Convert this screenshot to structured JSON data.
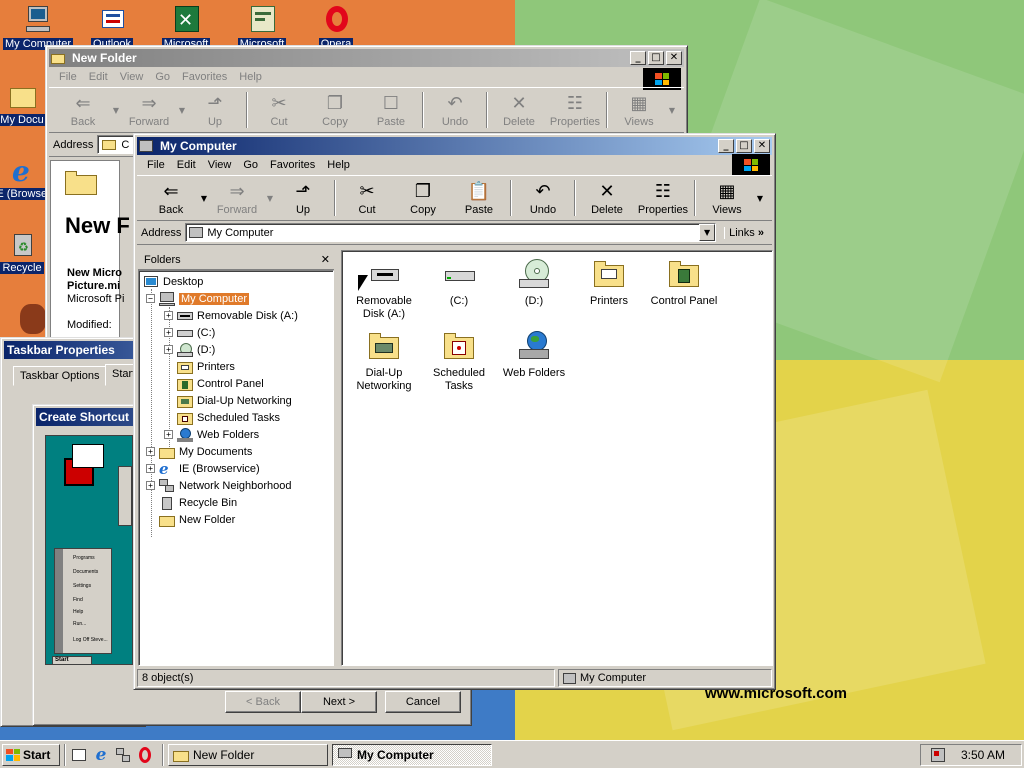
{
  "desktop": {
    "icons": [
      {
        "label": "My Computer",
        "icon": "computer-icon"
      },
      {
        "label": "Outlook",
        "icon": "outlook-icon"
      },
      {
        "label": "Microsoft",
        "icon": "excel-icon"
      },
      {
        "label": "Microsoft",
        "icon": "project-icon"
      },
      {
        "label": "Opera",
        "icon": "opera-icon"
      },
      {
        "label": "My Docu",
        "icon": "documents-folder-icon"
      },
      {
        "label": "IE (Browser",
        "icon": "ie-icon"
      },
      {
        "label": "Recycle",
        "icon": "recycle-bin-icon"
      }
    ],
    "watermark": "www.microsoft.com"
  },
  "new_folder_window": {
    "title": "New Folder",
    "menu": [
      "File",
      "Edit",
      "View",
      "Go",
      "Favorites",
      "Help"
    ],
    "toolbar": [
      "Back",
      "Forward",
      "Up",
      "Cut",
      "Copy",
      "Paste",
      "Undo",
      "Delete",
      "Properties",
      "Views"
    ],
    "address_label": "Address",
    "address_value": "C",
    "content_title": "New F",
    "content_lines": [
      "New Micro",
      "Picture.mi",
      "Microsoft Pi"
    ],
    "modified_label": "Modified:"
  },
  "taskbar_properties": {
    "title": "Taskbar Properties",
    "tabs": [
      "Taskbar Options",
      "Start"
    ]
  },
  "create_shortcut": {
    "title": "Create Shortcut",
    "preview_menu": [
      "Programs",
      "Documents",
      "Settings",
      "Find",
      "Help",
      "Run...",
      "Log Off Steve..."
    ],
    "preview_start": "Start",
    "buttons": {
      "back": "< Back",
      "next": "Next >",
      "cancel": "Cancel"
    }
  },
  "my_computer_window": {
    "title": "My Computer",
    "menu": [
      "File",
      "Edit",
      "View",
      "Go",
      "Favorites",
      "Help"
    ],
    "toolbar": [
      {
        "label": "Back",
        "glyph": "⇐",
        "enabled": true
      },
      {
        "label": "Forward",
        "glyph": "⇒",
        "enabled": false
      },
      {
        "label": "Up",
        "glyph": "⬏",
        "enabled": true
      },
      {
        "label": "Cut",
        "glyph": "✂",
        "enabled": true
      },
      {
        "label": "Copy",
        "glyph": "❐",
        "enabled": true
      },
      {
        "label": "Paste",
        "glyph": "📋",
        "enabled": true
      },
      {
        "label": "Undo",
        "glyph": "↶",
        "enabled": true
      },
      {
        "label": "Delete",
        "glyph": "✕",
        "enabled": true
      },
      {
        "label": "Properties",
        "glyph": "☷",
        "enabled": true
      },
      {
        "label": "Views",
        "glyph": "▦",
        "enabled": true
      }
    ],
    "address_label": "Address",
    "address_value": "My Computer",
    "links_label": "Links",
    "folders_header": "Folders",
    "tree": [
      {
        "label": "Desktop",
        "level": 0,
        "expander": "",
        "icon": "desktop-icon"
      },
      {
        "label": "My Computer",
        "level": 1,
        "expander": "−",
        "icon": "computer-icon",
        "selected": true
      },
      {
        "label": "Removable Disk (A:)",
        "level": 2,
        "expander": "+",
        "icon": "floppy-icon"
      },
      {
        "label": "(C:)",
        "level": 2,
        "expander": "+",
        "icon": "hard-drive-icon"
      },
      {
        "label": "(D:)",
        "level": 2,
        "expander": "+",
        "icon": "cd-drive-icon"
      },
      {
        "label": "Printers",
        "level": 2,
        "expander": "",
        "icon": "printers-folder-icon"
      },
      {
        "label": "Control Panel",
        "level": 2,
        "expander": "",
        "icon": "control-panel-icon"
      },
      {
        "label": "Dial-Up Networking",
        "level": 2,
        "expander": "",
        "icon": "dialup-icon"
      },
      {
        "label": "Scheduled Tasks",
        "level": 2,
        "expander": "",
        "icon": "scheduled-tasks-icon"
      },
      {
        "label": "Web Folders",
        "level": 2,
        "expander": "+",
        "icon": "web-folders-icon"
      },
      {
        "label": "My Documents",
        "level": 1,
        "expander": "+",
        "icon": "folder-icon"
      },
      {
        "label": "IE (Browservice)",
        "level": 1,
        "expander": "+",
        "icon": "ie-icon"
      },
      {
        "label": "Network Neighborhood",
        "level": 1,
        "expander": "+",
        "icon": "network-icon"
      },
      {
        "label": "Recycle Bin",
        "level": 1,
        "expander": "",
        "icon": "recycle-bin-icon"
      },
      {
        "label": "New Folder",
        "level": 1,
        "expander": "",
        "icon": "folder-icon"
      }
    ],
    "items": [
      {
        "label": "Removable Disk (A:)",
        "icon": "floppy-drive-icon"
      },
      {
        "label": "(C:)",
        "icon": "hard-drive-icon"
      },
      {
        "label": "(D:)",
        "icon": "cd-drive-icon"
      },
      {
        "label": "Printers",
        "icon": "printers-folder-icon"
      },
      {
        "label": "Control Panel",
        "icon": "control-panel-icon"
      },
      {
        "label": "Dial-Up Networking",
        "icon": "dialup-icon"
      },
      {
        "label": "Scheduled Tasks",
        "icon": "scheduled-tasks-icon"
      },
      {
        "label": "Web Folders",
        "icon": "web-folders-icon"
      }
    ],
    "status_count": "8 object(s)",
    "status_location": "My Computer"
  },
  "taskbar": {
    "start_label": "Start",
    "tasks": [
      {
        "label": "New Folder",
        "pressed": false
      },
      {
        "label": "My Computer",
        "pressed": true
      }
    ],
    "clock": "3:50 AM"
  },
  "colors": {
    "titlebar_active": "#0a246a",
    "face": "#d4d0c8",
    "selection": "#0a246a"
  }
}
